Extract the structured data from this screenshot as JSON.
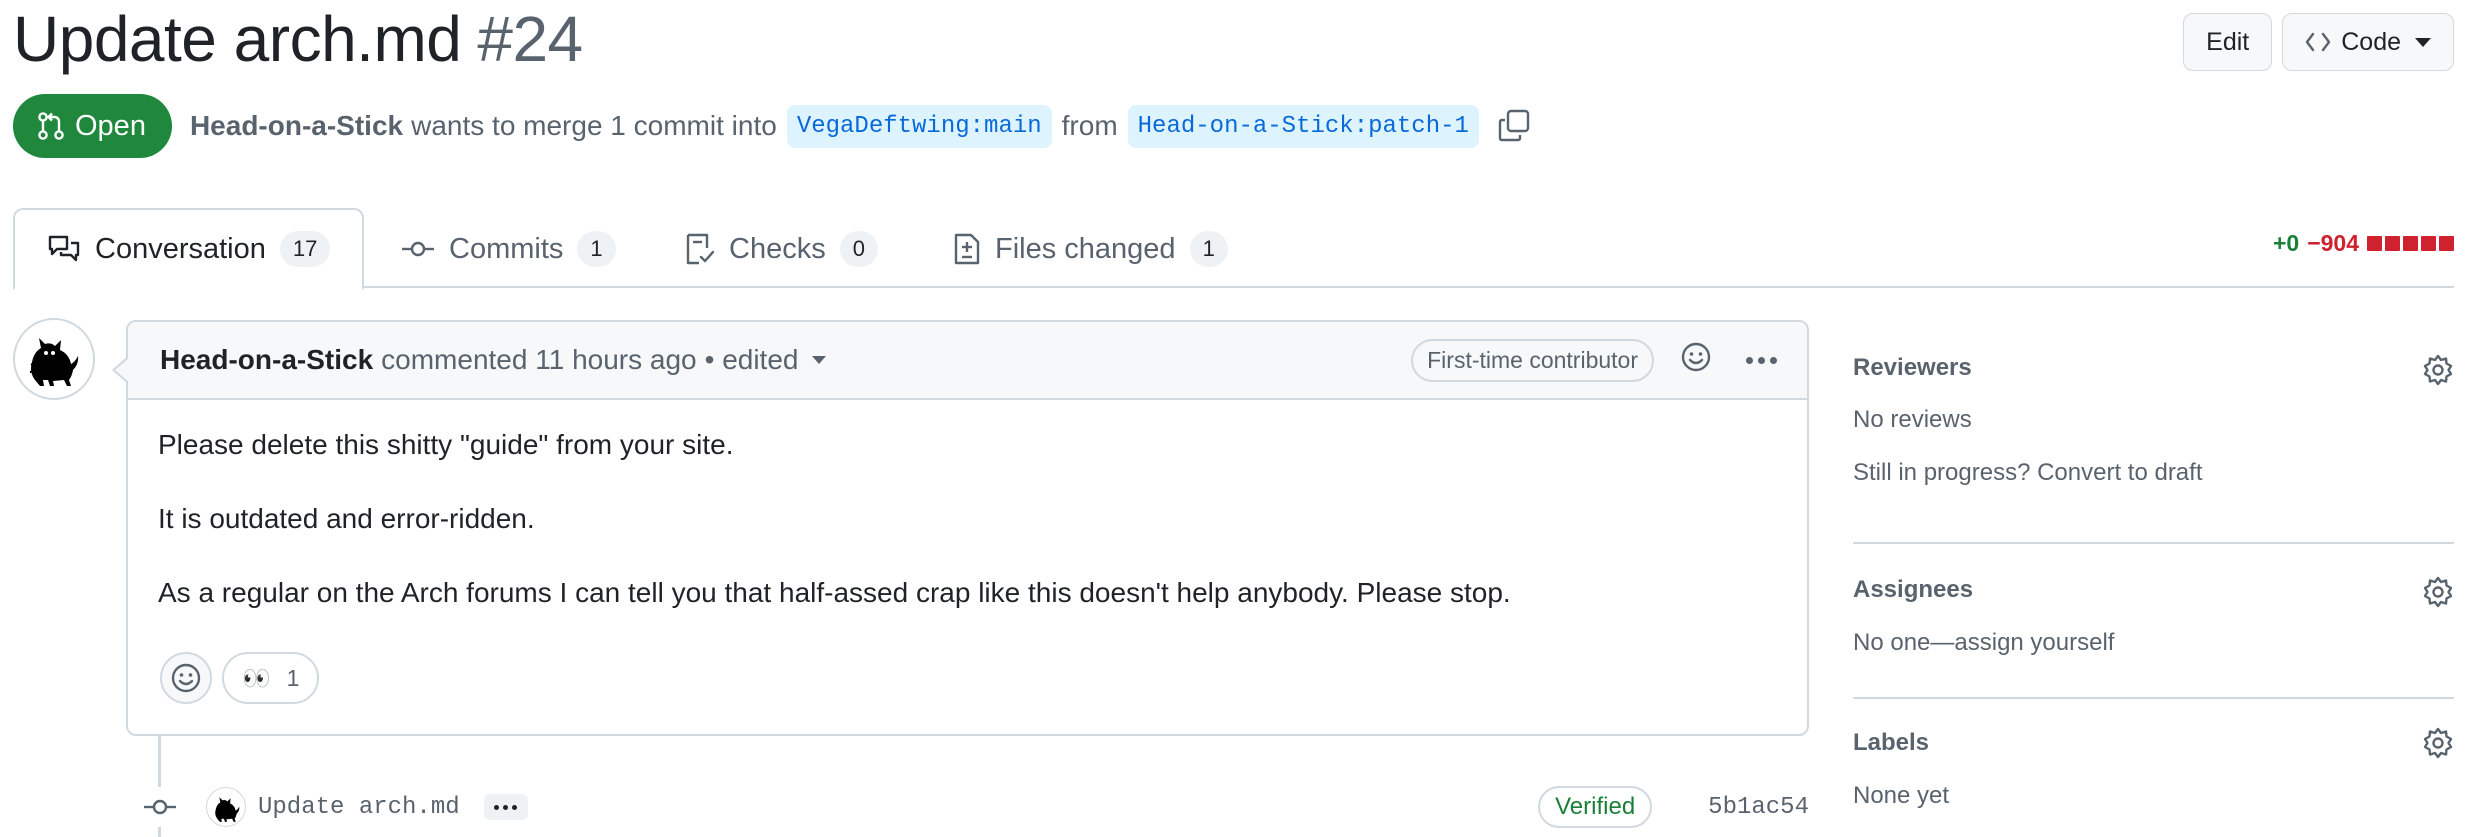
{
  "pr": {
    "title": "Update arch.md",
    "number": "#24",
    "state": "Open",
    "author": "Head-on-a-Stick",
    "merge_text": "wants to merge 1 commit into",
    "base_branch": "VegaDeftwing:main",
    "from_text": "from",
    "head_branch": "Head-on-a-Stick:patch-1"
  },
  "header_actions": {
    "edit": "Edit",
    "code": "Code"
  },
  "tabs": [
    {
      "label": "Conversation",
      "count": "17"
    },
    {
      "label": "Commits",
      "count": "1"
    },
    {
      "label": "Checks",
      "count": "0"
    },
    {
      "label": "Files changed",
      "count": "1"
    }
  ],
  "diffstat": {
    "additions": "+0",
    "deletions": "−904"
  },
  "comment": {
    "author": "Head-on-a-Stick",
    "action": "commented 11 hours ago",
    "edited": "• edited",
    "badge": "First-time contributor",
    "paragraphs": [
      "Please delete this shitty \"guide\" from your site.",
      "It is outdated and error-ridden.",
      "As a regular on the Arch forums I can tell you that half-assed crap like this doesn't help anybody. Please stop."
    ],
    "reaction": {
      "emoji": "👀",
      "count": "1"
    }
  },
  "commit": {
    "message": "Update arch.md",
    "verified": "Verified",
    "sha": "5b1ac54"
  },
  "sidebar": {
    "reviewers": {
      "title": "Reviewers",
      "value": "No reviews",
      "hint": "Still in progress? Convert to draft"
    },
    "assignees": {
      "title": "Assignees",
      "value": "No one—assign yourself"
    },
    "labels": {
      "title": "Labels",
      "value": "None yet"
    }
  },
  "colors": {
    "open_green": "#1f883d",
    "link_blue": "#0969da",
    "branch_bg": "#ddf4ff",
    "deletion_red": "#cf222e",
    "addition_green": "#1a7f37",
    "border": "#d1d9e0"
  }
}
